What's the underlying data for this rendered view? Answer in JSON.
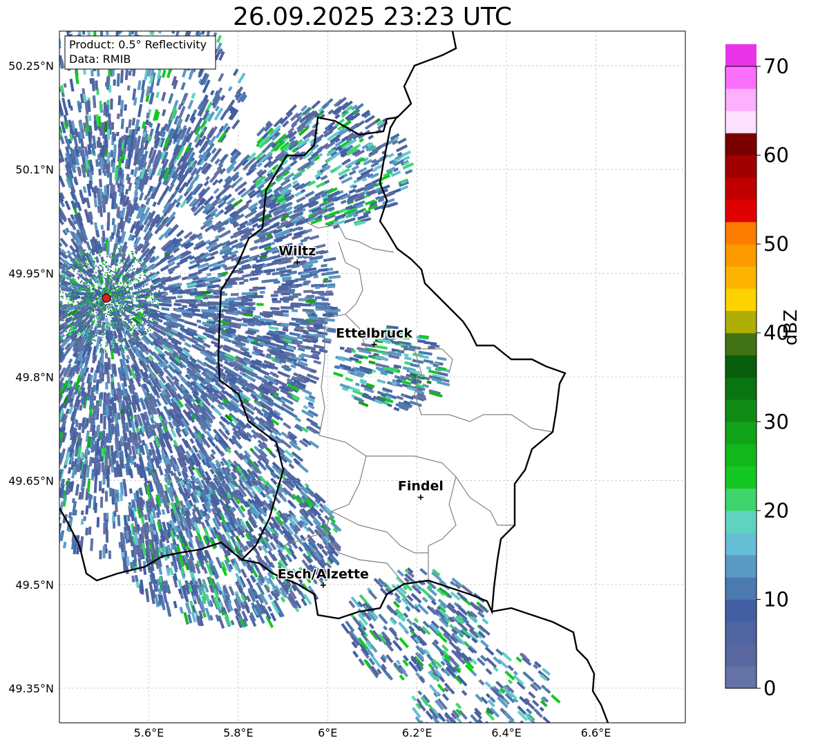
{
  "title": "26.09.2025 23:23 UTC",
  "info_box": {
    "product": "Product: 0.5° Reflectivity",
    "data": "Data: RMIB"
  },
  "map": {
    "lon_range": [
      5.4,
      6.8
    ],
    "lat_range": [
      49.3,
      50.3
    ],
    "lon_ticks": [
      {
        "value": 5.6,
        "label": "5.6°E"
      },
      {
        "value": 5.8,
        "label": "5.8°E"
      },
      {
        "value": 6.0,
        "label": "6°E"
      },
      {
        "value": 6.2,
        "label": "6.2°E"
      },
      {
        "value": 6.4,
        "label": "6.4°E"
      },
      {
        "value": 6.6,
        "label": "6.6°E"
      }
    ],
    "lat_ticks": [
      {
        "value": 50.25,
        "label": "50.25°N"
      },
      {
        "value": 50.1,
        "label": "50.1°N"
      },
      {
        "value": 49.95,
        "label": "49.95°N"
      },
      {
        "value": 49.8,
        "label": "49.8°N"
      },
      {
        "value": 49.65,
        "label": "49.65°N"
      },
      {
        "value": 49.5,
        "label": "49.5°N"
      },
      {
        "value": 49.35,
        "label": "49.35°N"
      }
    ],
    "grid": true,
    "radar_site": {
      "lon": 5.505,
      "lat": 49.914
    },
    "cities": [
      {
        "name": "Wiltz",
        "lon": 5.932,
        "lat": 49.966
      },
      {
        "name": "Ettelbruck",
        "lon": 6.104,
        "lat": 49.847
      },
      {
        "name": "Findel",
        "lon": 6.208,
        "lat": 49.626
      },
      {
        "name": "Esch/Alzette",
        "lon": 5.99,
        "lat": 49.499
      }
    ],
    "border_color": "#000000",
    "canton_color": "#808080"
  },
  "colorbar": {
    "label": "dBZ",
    "min": 0,
    "max": 70,
    "step": 2.5,
    "ticks": [
      "0",
      "10",
      "20",
      "30",
      "40",
      "50",
      "60",
      "70"
    ],
    "colors": [
      "#6472a6",
      "#5867a0",
      "#4f64a0",
      "#435fa3",
      "#4b79b0",
      "#5b9ac4",
      "#66bdd6",
      "#5fd3bf",
      "#3dd56c",
      "#14c822",
      "#12b81b",
      "#13a318",
      "#0f8b14",
      "#0a7510",
      "#085e0d",
      "#427216",
      "#adaf04",
      "#fdd300",
      "#fcb400",
      "#fc9a00",
      "#fd7d00",
      "#e10000",
      "#c00000",
      "#a00000",
      "#7b0000",
      "#fde0fd",
      "#fdb0fd",
      "#fd6ffd",
      "#e935e8"
    ]
  }
}
